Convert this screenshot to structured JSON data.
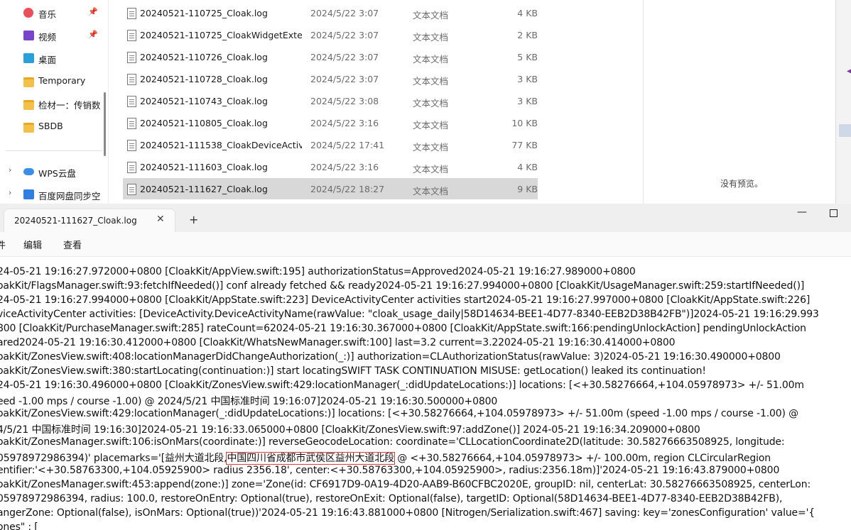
{
  "nav": {
    "items": [
      {
        "label": "音乐",
        "icon": "music-icon",
        "pinned": true
      },
      {
        "label": "视频",
        "icon": "video-icon",
        "pinned": true
      },
      {
        "label": "桌面",
        "icon": "desktop-icon",
        "pinned": false
      },
      {
        "label": "Temporary",
        "icon": "folder-icon",
        "pinned": false
      },
      {
        "label": "检材一：传销数",
        "icon": "folder-icon",
        "pinned": false
      },
      {
        "label": "SBDB",
        "icon": "folder-icon",
        "pinned": false
      }
    ],
    "cloud_items": [
      {
        "label": "WPS云盘",
        "icon": "wps-cloud-icon"
      },
      {
        "label": "百度网盘同步空",
        "icon": "baidu-netdisk-icon"
      }
    ]
  },
  "files": [
    {
      "name": "20240521-110725_Cloak.log",
      "date": "2024/5/22 3:07",
      "type": "文本文档",
      "size": "4 KB"
    },
    {
      "name": "20240521-110725_CloakWidgetExten...",
      "date": "2024/5/22 3:07",
      "type": "文本文档",
      "size": "2 KB"
    },
    {
      "name": "20240521-110726_Cloak.log",
      "date": "2024/5/22 3:07",
      "type": "文本文档",
      "size": "5 KB"
    },
    {
      "name": "20240521-110728_Cloak.log",
      "date": "2024/5/22 3:07",
      "type": "文本文档",
      "size": "3 KB"
    },
    {
      "name": "20240521-110743_Cloak.log",
      "date": "2024/5/22 3:08",
      "type": "文本文档",
      "size": "3 KB"
    },
    {
      "name": "20240521-110805_Cloak.log",
      "date": "2024/5/22 3:16",
      "type": "文本文档",
      "size": "10 KB"
    },
    {
      "name": "20240521-111538_CloakDeviceActivit...",
      "date": "2024/5/22 17:41",
      "type": "文本文档",
      "size": "77 KB"
    },
    {
      "name": "20240521-111603_Cloak.log",
      "date": "2024/5/22 3:16",
      "type": "文本文档",
      "size": "4 KB"
    },
    {
      "name": "20240521-111627_Cloak.log",
      "date": "2024/5/22 18:27",
      "type": "文本文档",
      "size": "9 KB",
      "selected": true
    }
  ],
  "preview": {
    "text": "没有预览。"
  },
  "notepad": {
    "tab_title": "20240521-111627_Cloak.log",
    "tab_close": "✕",
    "new_tab": "+",
    "minimize": "—",
    "menu": [
      "件",
      "编辑",
      "查看"
    ],
    "lines": [
      "24-05-21 19:16:27.972000+0800 [CloakKit/AppView.swift:195] authorizationStatus=Approved2024-05-21 19:16:27.989000+0800",
      "oakKit/FlagsManager.swift:93:fetchIfNeeded()] conf already fetched && ready2024-05-21 19:16:27.994000+0800 [CloakKit/UsageManager.swift:259:startIfNeeded()]",
      "24-05-21 19:16:27.994000+0800 [CloakKit/AppState.swift:223] DeviceActivityCenter activities start2024-05-21 19:16:27.997000+0800 [CloakKit/AppState.swift:226]",
      "viceActivityCenter activities: [DeviceActivity.DeviceActivityName(rawValue: \"cloak_usage_daily|58D14634-BEE1-4D77-8340-EEB2D38B42FB\")]2024-05-21 19:16:29.993",
      "800 [CloakKit/PurchaseManager.swift:285] rateCount=62024-05-21 19:16:30.367000+0800 [CloakKit/AppState.swift:166:pendingUnlockAction] pendingUnlockAction",
      "ared2024-05-21 19:16:30.412000+0800 [CloakKit/WhatsNewManager.swift:100] last=3.2 current=3.22024-05-21 19:16:30.414000+0800",
      "oakKit/ZonesView.swift:408:locationManagerDidChangeAuthorization(_:)] authorization=CLAuthorizationStatus(rawValue: 3)2024-05-21 19:16:30.490000+0800",
      "oakKit/ZonesView.swift:380:startLocating(continuation:)] start locatingSWIFT TASK CONTINUATION MISUSE: getLocation() leaked its continuation!",
      "24-05-21 19:16:30.496000+0800 [CloakKit/ZonesView.swift:429:locationManager(_:didUpdateLocations:)] locations: [<+30.58276664,+104.05978973> +/- 51.00m",
      "eed -1.00 mps / course -1.00) @ 2024/5/21 中国标准时间 19:16:07]2024-05-21 19:16:30.500000+0800",
      "oakKit/ZonesView.swift:429:locationManager(_:didUpdateLocations:)] locations: [<+30.58276664,+104.05978973> +/- 51.00m (speed -1.00 mps / course -1.00) @",
      "4/5/21 中国标准时间 19:16:30]2024-05-21 19:16:33.065000+0800 [CloakKit/ZonesView.swift:97:addZone()] 2024-05-21 19:16:34.209000+0800",
      "oakKit/ZonesManager.swift:106:isOnMars(coordinate:)] reverseGeocodeLocation: coordinate='CLLocationCoordinate2D(latitude: 30.58276663508925, longitude:",
      "05978972986394)' placemarks='[益州大道北段,",
      "entifier:'<+30.58763300,+104.05925900> radius 2356.18', center:<+30.58763300,+104.05925900>, radius:2356.18m)]'2024-05-21 19:16:43.879000+0800",
      "oakKit/ZonesManager.swift:453:append(zone:)] zone='Zone(id: CF6917D9-0A19-4D20-AAB9-B60CFBC2020E, groupID: nil, centerLat: 30.58276663508925, centerLon:",
      "05978972986394, radius: 100.0, restoreOnEntry: Optional(true), restoreOnExit: Optional(false), targetID: Optional(58D14634-BEE1-4D77-8340-EEB2D38B42FB),",
      "angerZone: Optional(false), isOnMars: Optional(true))'2024-05-21 19:16:43.881000+0800 [Nitrogen/Serialization.swift:467] saving: key='zonesConfiguration' value='{",
      "ones\" : ["
    ],
    "highlight": "中国四川省成都市武侯区益州大道北段",
    "line13_tail": " @ <+30.58276664,+104.05978973> +/- 100.00m, region CLCircularRegion"
  },
  "colors": {
    "highlight_box": "#e23b3b",
    "selection": "#d8d8d8"
  }
}
